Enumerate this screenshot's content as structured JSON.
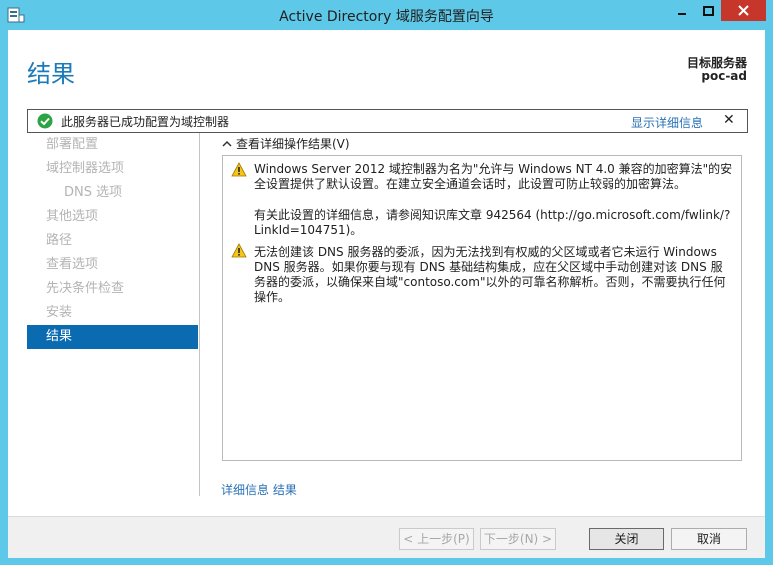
{
  "window": {
    "title": "Active Directory 域服务配置向导"
  },
  "header": {
    "title": "结果",
    "target_label": "目标服务器",
    "target_server": "poc-ad"
  },
  "banner": {
    "message": "此服务器已成功配置为域控制器",
    "details_link": "显示详细信息"
  },
  "nav": {
    "items": [
      {
        "label": "部署配置"
      },
      {
        "label": "域控制器选项"
      },
      {
        "label": "DNS 选项"
      },
      {
        "label": "其他选项"
      },
      {
        "label": "路径"
      },
      {
        "label": "查看选项"
      },
      {
        "label": "先决条件检查"
      },
      {
        "label": "安装"
      },
      {
        "label": "结果"
      }
    ]
  },
  "results": {
    "section_header": "查看详细操作结果(V)",
    "messages": [
      {
        "text": "Windows Server 2012 域控制器为名为\"允许与 Windows NT 4.0 兼容的加密算法\"的安全设置提供了默认设置。在建立安全通道会话时，此设置可防止较弱的加密算法。"
      },
      {
        "text": "有关此设置的详细信息，请参阅知识库文章 942564 (http://go.microsoft.com/fwlink/?LinkId=104751)。"
      },
      {
        "text": "无法创建该 DNS 服务器的委派，因为无法找到有权威的父区域或者它未运行 Windows DNS 服务器。如果你要与现有 DNS 基础结构集成，应在父区域中手动创建对该 DNS 服务器的委派，以确保来自域\"contoso.com\"以外的可靠名称解析。否则，不需要执行任何操作。"
      }
    ],
    "more_link": "详细信息 结果"
  },
  "footer": {
    "back": "< 上一步(P)",
    "next": "下一步(N) >",
    "close": "关闭",
    "cancel": "取消"
  },
  "colors": {
    "titlebar": "#5ec8e8",
    "accent": "#1b7ab9",
    "nav_selected": "#0a6bb0",
    "close_button": "#c7362b",
    "success": "#2ca444",
    "warning": "#f5c518"
  }
}
